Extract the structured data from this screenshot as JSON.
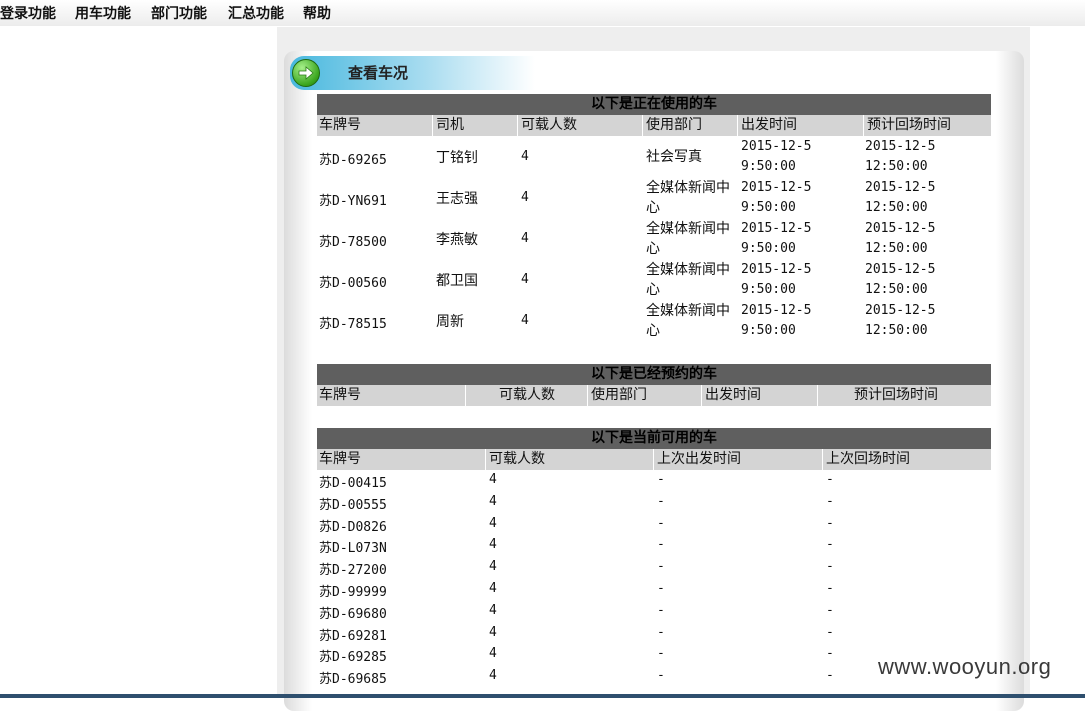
{
  "menu": [
    {
      "label": "登录功能"
    },
    {
      "label": "用车功能"
    },
    {
      "label": "部门功能"
    },
    {
      "label": "汇总功能"
    },
    {
      "label": "帮助"
    }
  ],
  "page": {
    "title": "查看车况",
    "icon": "arrow-right-circle-icon"
  },
  "in_use": {
    "title": "以下是正在使用的车",
    "headers": [
      "车牌号",
      "司机",
      "可载人数",
      "使用部门",
      "出发时间",
      "预计回场时间"
    ],
    "rows": [
      [
        "苏D-69265",
        "丁铭钊",
        "4",
        "社会写真",
        "2015-12-5 9:50:00",
        "2015-12-5 12:50:00"
      ],
      [
        "苏D-YN691",
        "王志强",
        "4",
        "全媒体新闻中心",
        "2015-12-5 9:50:00",
        "2015-12-5 12:50:00"
      ],
      [
        "苏D-78500",
        "李燕敏",
        "4",
        "全媒体新闻中心",
        "2015-12-5 9:50:00",
        "2015-12-5 12:50:00"
      ],
      [
        "苏D-00560",
        "都卫国",
        "4",
        "全媒体新闻中心",
        "2015-12-5 9:50:00",
        "2015-12-5 12:50:00"
      ],
      [
        "苏D-78515",
        "周新",
        "4",
        "全媒体新闻中心",
        "2015-12-5 9:50:00",
        "2015-12-5 12:50:00"
      ]
    ]
  },
  "reserved": {
    "title": "以下是已经预约的车",
    "headers": [
      "车牌号",
      "可载人数",
      "使用部门",
      "出发时间",
      "预计回场时间"
    ],
    "rows": []
  },
  "available": {
    "title": "以下是当前可用的车",
    "headers": [
      "车牌号",
      "可载人数",
      "上次出发时间",
      "上次回场时间"
    ],
    "rows": [
      [
        "苏D-00415",
        "4",
        "-",
        "-"
      ],
      [
        "苏D-00555",
        "4",
        "-",
        "-"
      ],
      [
        "苏D-D0826",
        "4",
        "-",
        "-"
      ],
      [
        "苏D-L073N",
        "4",
        "-",
        "-"
      ],
      [
        "苏D-27200",
        "4",
        "-",
        "-"
      ],
      [
        "苏D-99999",
        "4",
        "-",
        "-"
      ],
      [
        "苏D-69680",
        "4",
        "-",
        "-"
      ],
      [
        "苏D-69281",
        "4",
        "-",
        "-"
      ],
      [
        "苏D-69285",
        "4",
        "-",
        "-"
      ],
      [
        "苏D-69685",
        "4",
        "-",
        "-"
      ]
    ]
  },
  "watermark": "www.wooyun.org"
}
